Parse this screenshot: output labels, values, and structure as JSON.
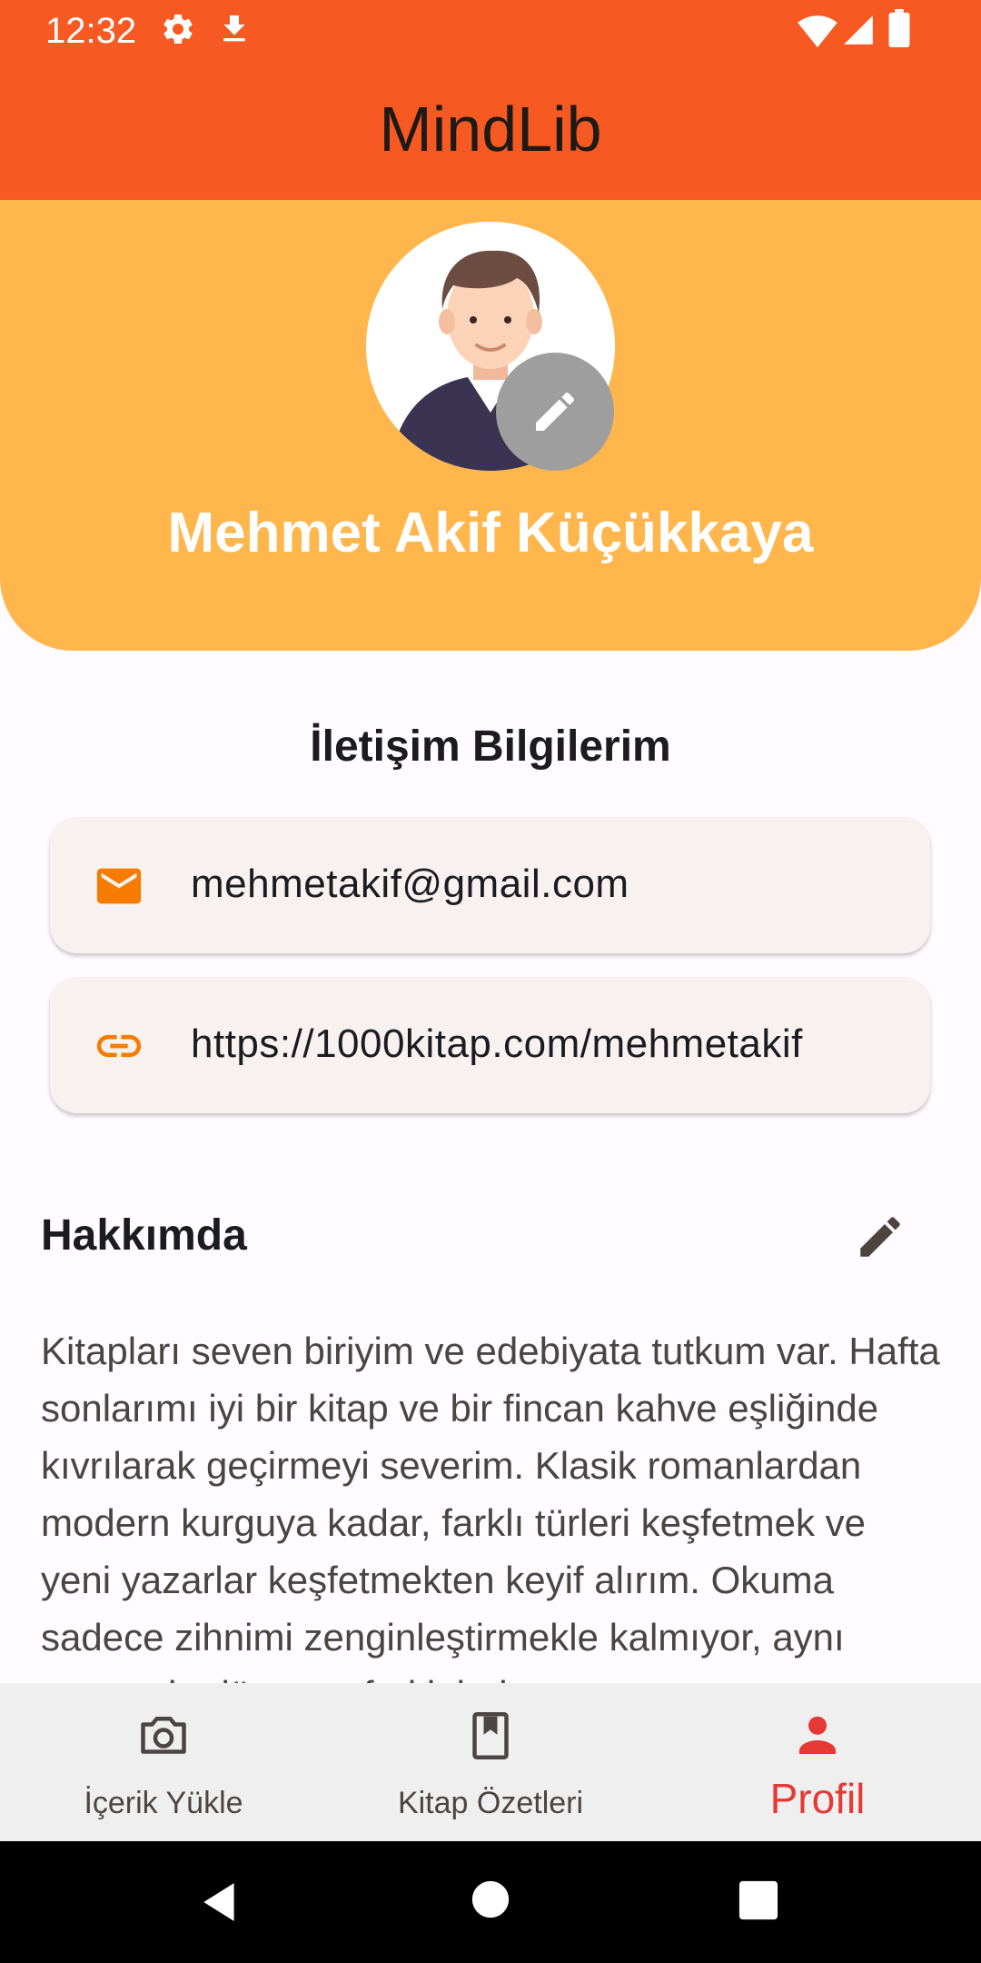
{
  "status_bar": {
    "time": "12:32",
    "icons": [
      "settings-icon",
      "download-icon",
      "wifi-icon",
      "signal-icon",
      "battery-icon"
    ]
  },
  "app": {
    "title": "MindLib"
  },
  "profile": {
    "name": "Mehmet Akif Küçükkaya",
    "header_color": "#FFB64C",
    "edit_avatar_icon": "pencil-icon"
  },
  "contact": {
    "title": "İletişim Bilgilerim",
    "email": "mehmetakif@gmail.com",
    "link": "https://1000kitap.com/mehmetakif",
    "accent": "#F57C00"
  },
  "about": {
    "title": "Hakkımda",
    "text": "Kitapları seven biriyim ve edebiyata tutkum var. Hafta sonlarımı iyi bir kitap ve bir fincan kahve eşliğinde kıvrılarak geçirmeyi severim. Klasik romanlardan modern kurguya kadar, farklı türleri keşfetmek ve yeni yazarlar keşfetmekten keyif alırım. Okuma sadece zihnimi zenginleştirmekle kalmıyor, aynı zamanda dünyaya farklı bakış"
  },
  "bottom_nav": {
    "items": [
      {
        "label": "İçerik Yükle",
        "icon": "camera-icon",
        "active": false
      },
      {
        "label": "Kitap Özetleri",
        "icon": "book-icon",
        "active": false
      },
      {
        "label": "Profil",
        "icon": "person-icon",
        "active": true
      }
    ],
    "active_color": "#E53935"
  },
  "colors": {
    "app_bar": "#F65A22",
    "background": "#FFFBFE",
    "card": "#F7F2EF"
  }
}
